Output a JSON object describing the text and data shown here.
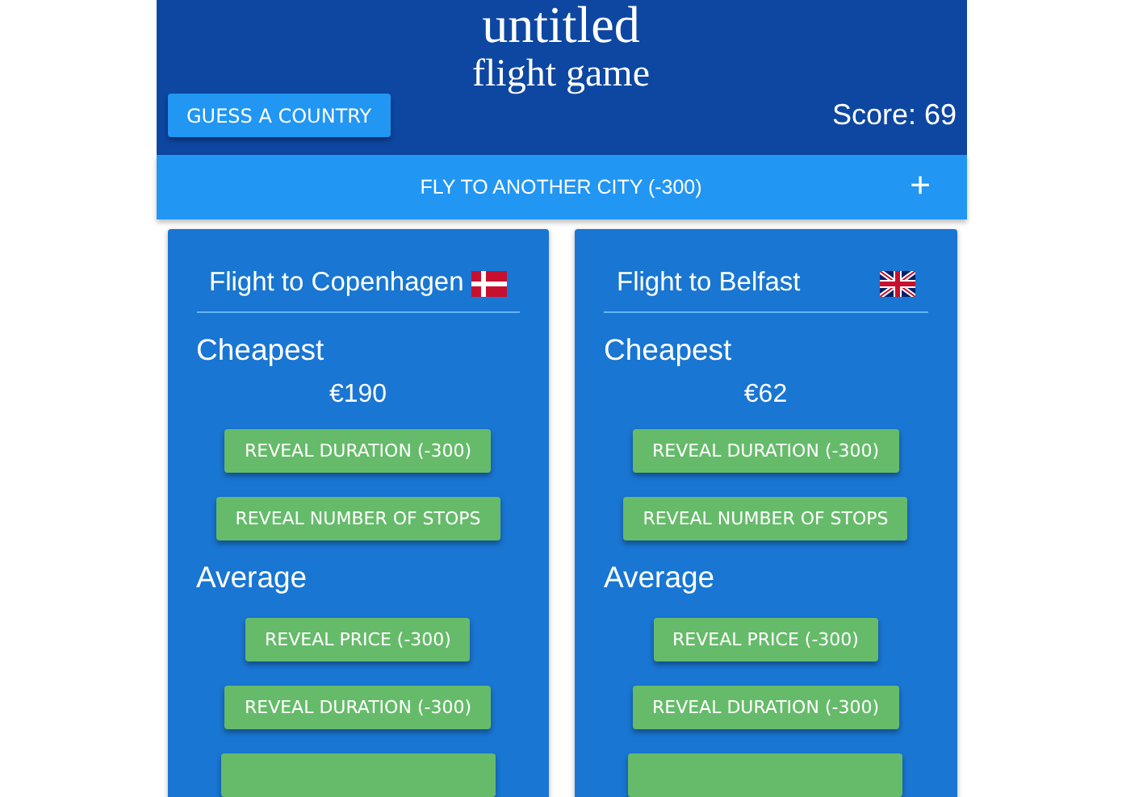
{
  "header": {
    "title": "untitled",
    "subtitle": "flight game",
    "guess_button": "GUESS A COUNTRY",
    "score": "Score: 69"
  },
  "fly_bar": {
    "label": "FLY TO ANOTHER CITY (-300)",
    "icon": "+"
  },
  "cards": [
    {
      "title": "Flight to Copenhagen",
      "kind": "dk",
      "sections": [
        {
          "heading": "Cheapest",
          "price": "€190",
          "buttons": [
            "REVEAL DURATION (-300)",
            "REVEAL NUMBER OF STOPS"
          ]
        },
        {
          "heading": "Average",
          "buttons": [
            "REVEAL PRICE (-300)",
            "REVEAL DURATION (-300)"
          ],
          "more_below": true
        }
      ]
    },
    {
      "title": "Flight to Belfast",
      "kind": "gb",
      "sections": [
        {
          "heading": "Cheapest",
          "price": "€62",
          "buttons": [
            "REVEAL DURATION (-300)",
            "REVEAL NUMBER OF STOPS"
          ]
        },
        {
          "heading": "Average",
          "buttons": [
            "REVEAL PRICE (-300)",
            "REVEAL DURATION (-300)"
          ],
          "more_below": true
        }
      ]
    }
  ]
}
